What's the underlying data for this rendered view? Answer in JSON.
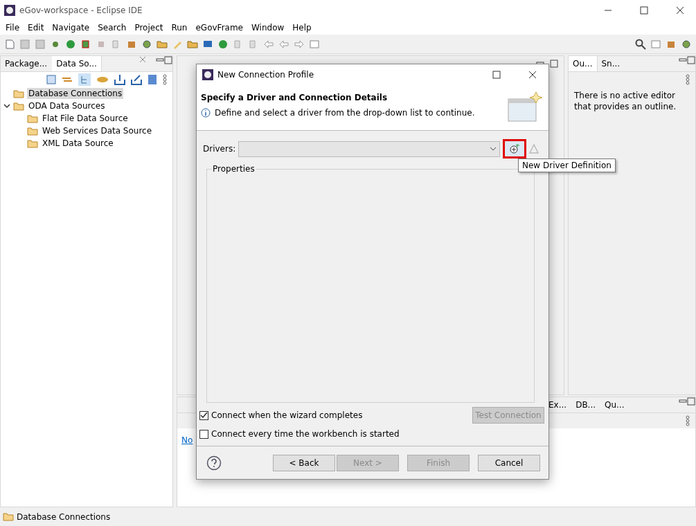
{
  "window": {
    "title": "eGov-workspace - Eclipse IDE"
  },
  "menu": [
    "File",
    "Edit",
    "Navigate",
    "Search",
    "Project",
    "Run",
    "eGovFrame",
    "Window",
    "Help"
  ],
  "left_panel": {
    "tabs": [
      {
        "label": "Package...",
        "selected": false
      },
      {
        "label": "Data So...",
        "selected": true
      }
    ],
    "tree": [
      {
        "label": "Database Connections",
        "selected": true
      },
      {
        "label": "ODA Data Sources",
        "selected": false,
        "expanded": true,
        "children": [
          {
            "label": "Flat File Data Source",
            "selected": false
          },
          {
            "label": "Web Services Data Source",
            "selected": false
          },
          {
            "label": "XML Data Source",
            "selected": false
          }
        ]
      }
    ]
  },
  "right_panel": {
    "tabs": [
      {
        "label": "Ou...",
        "selected": true
      },
      {
        "label": "Sn...",
        "selected": false
      }
    ],
    "message": "There is no active editor that provides an outline."
  },
  "bottom_panel": {
    "tabs": [
      "Ex...",
      "DB...",
      "Qu..."
    ],
    "link": "No"
  },
  "status_bar": {
    "text": "Database Connections"
  },
  "dialog": {
    "title": "New Connection Profile",
    "heading": "Specify a Driver and Connection Details",
    "message": "Define and select a driver from the drop-down list to continue.",
    "drivers_label": "Drivers:",
    "properties_label": "Properties",
    "tooltip": "New Driver Definition",
    "options": [
      {
        "label": "Connect when the wizard completes",
        "checked": true
      },
      {
        "label": "Connect every time the workbench is started",
        "checked": false
      }
    ],
    "test_button": {
      "label": "Test Connection",
      "disabled": true
    },
    "buttons": [
      {
        "label": "< Back",
        "disabled": false
      },
      {
        "label": "Next >",
        "disabled": true
      },
      {
        "label": "Finish",
        "disabled": true
      },
      {
        "label": "Cancel",
        "disabled": false
      }
    ]
  }
}
